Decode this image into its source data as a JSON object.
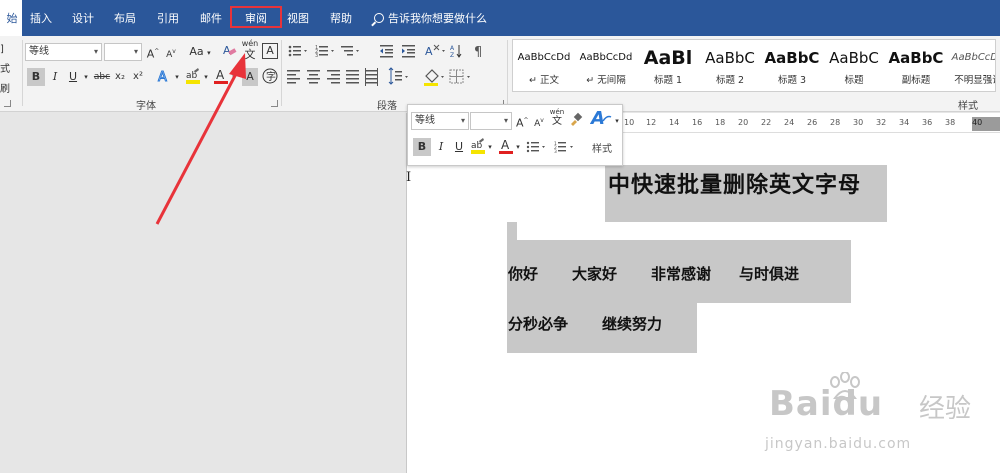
{
  "tabs": {
    "start_fragment": "始",
    "items": [
      "插入",
      "设计",
      "布局",
      "引用",
      "邮件",
      "审阅",
      "视图",
      "帮助"
    ],
    "tell_me": "告诉我你想要做什么"
  },
  "ribbon": {
    "clipboard_fragments": [
      "",
      "]",
      "式刷"
    ],
    "font_name": "等线",
    "font_size": "",
    "grow_font": "A",
    "shrink_font": "A",
    "change_case": "Aa",
    "phonetic": "wén",
    "phonetic_char": "文",
    "char_border": "A",
    "bold": "B",
    "italic": "I",
    "underline": "U",
    "strikethrough": "abc",
    "subscript": "x₂",
    "superscript": "x²",
    "font_group_label": "字体",
    "paragraph_group_label": "段落",
    "styles_group_label": "样式",
    "styles": [
      {
        "preview": "AaBbCcDd",
        "name": "↵ 正文"
      },
      {
        "preview": "AaBbCcDd",
        "name": "↵ 无间隔"
      },
      {
        "preview": "AaBl",
        "name": "标题 1"
      },
      {
        "preview": "AaBbC",
        "name": "标题 2"
      },
      {
        "preview": "AaBbC",
        "name": "标题 3"
      },
      {
        "preview": "AaBbC",
        "name": "标题"
      },
      {
        "preview": "AaBbC",
        "name": "副标题"
      },
      {
        "preview": "AaBbCcDd",
        "name": "不明显强调"
      }
    ]
  },
  "ruler": {
    "ticks": [
      "10",
      "12",
      "14",
      "16",
      "18",
      "20",
      "22",
      "24",
      "26",
      "28",
      "30",
      "32",
      "34",
      "36",
      "38",
      "40"
    ]
  },
  "mini_toolbar": {
    "font_name": "等线",
    "font_size": "",
    "grow": "A",
    "shrink": "A",
    "phonetic": "wén",
    "bold": "B",
    "italic": "I",
    "underline": "U",
    "font_color_glyph": "A",
    "styles_label": "样式"
  },
  "document": {
    "title": "中快速批量删除英文字母",
    "line1": [
      "你好",
      "大家好",
      "非常感谢",
      "与时俱进"
    ],
    "line2": [
      "分秒必争",
      "继续努力"
    ]
  },
  "watermark": {
    "brand": "Baidu",
    "brand_cn": "经验",
    "url": "jingyan.baidu.com"
  },
  "colors": {
    "tab_bar": "#2b579a",
    "highlight_box": "#e8333a",
    "arrow": "#e8333a",
    "selection": "#c8c8c8"
  }
}
